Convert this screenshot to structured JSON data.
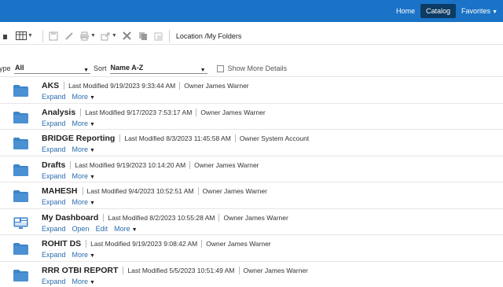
{
  "topnav": {
    "home": "Home",
    "catalog": "Catalog",
    "favorites": "Favorites"
  },
  "toolbar": {
    "location_label": "Location",
    "location_value": "/My Folders"
  },
  "filter": {
    "type_label": "ype",
    "type_value": "All",
    "sort_label": "Sort",
    "sort_value": "Name A-Z",
    "show_more_details": "Show More Details"
  },
  "items": [
    {
      "name": "AKS",
      "modified": "Last Modified 9/19/2023 9:33:44 AM",
      "owner": "Owner James Warner",
      "kind": "folder",
      "actions": [
        "Expand"
      ],
      "more": "More"
    },
    {
      "name": "Analysis",
      "modified": "Last Modified 9/17/2023 7:53:17 AM",
      "owner": "Owner James Warner",
      "kind": "folder",
      "actions": [
        "Expand"
      ],
      "more": "More"
    },
    {
      "name": "BRIDGE Reporting",
      "modified": "Last Modified 8/3/2023 11:45:58 AM",
      "owner": "Owner System Account",
      "kind": "folder",
      "actions": [
        "Expand"
      ],
      "more": "More"
    },
    {
      "name": "Drafts",
      "modified": "Last Modified 9/19/2023 10:14:20 AM",
      "owner": "Owner James Warner",
      "kind": "folder",
      "actions": [
        "Expand"
      ],
      "more": "More"
    },
    {
      "name": "MAHESH",
      "modified": "Last Modified 9/4/2023 10:52:51 AM",
      "owner": "Owner James Warner",
      "kind": "folder",
      "actions": [
        "Expand"
      ],
      "more": "More"
    },
    {
      "name": "My Dashboard",
      "modified": "Last Modified 8/2/2023 10:55:28 AM",
      "owner": "Owner James Warner",
      "kind": "dashboard",
      "actions": [
        "Expand",
        "Open",
        "Edit"
      ],
      "more": "More"
    },
    {
      "name": "ROHIT DS",
      "modified": "Last Modified 9/19/2023 9:08:42 AM",
      "owner": "Owner James Warner",
      "kind": "folder",
      "actions": [
        "Expand"
      ],
      "more": "More"
    },
    {
      "name": "RRR OTBI REPORT",
      "modified": "Last Modified 5/5/2023 10:51:49 AM",
      "owner": "Owner James Warner",
      "kind": "folder",
      "actions": [
        "Expand"
      ],
      "more": "More"
    }
  ],
  "colors": {
    "topbar": "#1a73c6",
    "active_nav": "#0d3b63",
    "folder": "#3d84c8",
    "link": "#2a6cb0"
  }
}
